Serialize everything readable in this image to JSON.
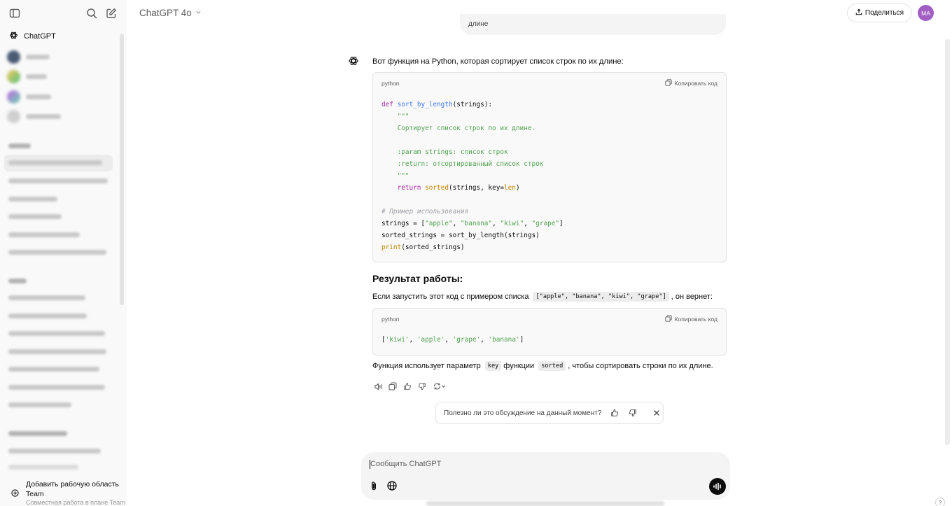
{
  "sidebar": {
    "chatgpt_label": "ChatGPT",
    "workspace": {
      "title": "Добавить рабочую область",
      "title2": "Team",
      "subtitle": "Совместная работа в плане Team"
    }
  },
  "header": {
    "model_name": "ChatGPT 4o",
    "share_label": "Поделиться",
    "avatar_initials": "MA"
  },
  "chat": {
    "prev_message_tail": "длине",
    "intro": "Вот функция на Python, которая сортирует список строк по их длине:",
    "code1": {
      "lang": "python",
      "copy_label": "Копировать код",
      "lines": [
        "def sort_by_length(strings):",
        "    \"\"\"",
        "    Сортирует список строк по их длине.",
        "",
        "    :param strings: список строк",
        "    :return: отсортированный список строк",
        "    \"\"\"",
        "    return sorted(strings, key=len)",
        "",
        "# Пример использования",
        "strings = [\"apple\", \"banana\", \"kiwi\", \"grape\"]",
        "sorted_strings = sort_by_length(strings)",
        "print(sorted_strings)"
      ]
    },
    "result_heading": "Результат работы:",
    "result_para": {
      "before": "Если запустить этот код с примером списка",
      "code": "[\"apple\", \"banana\", \"kiwi\", \"grape\"]",
      "after": ", он вернет:"
    },
    "code2": {
      "lang": "python",
      "copy_label": "Копировать код",
      "lines": [
        "['kiwi', 'apple', 'grape', 'banana']"
      ]
    },
    "final_para": {
      "p1": "Функция использует параметр",
      "c1": "key",
      "p2": "функции",
      "c2": "sorted",
      "p3": ", чтобы сортировать строки по их длине."
    }
  },
  "feedback": {
    "question": "Полезно ли это обсуждение на данный момент?"
  },
  "composer": {
    "placeholder": "Сообщить ChatGPT"
  },
  "help": "?",
  "colors": {
    "avatar": "#a25fc3",
    "sidebar_bg": "#f9f9f9",
    "composer_bg": "#f4f4f4"
  }
}
